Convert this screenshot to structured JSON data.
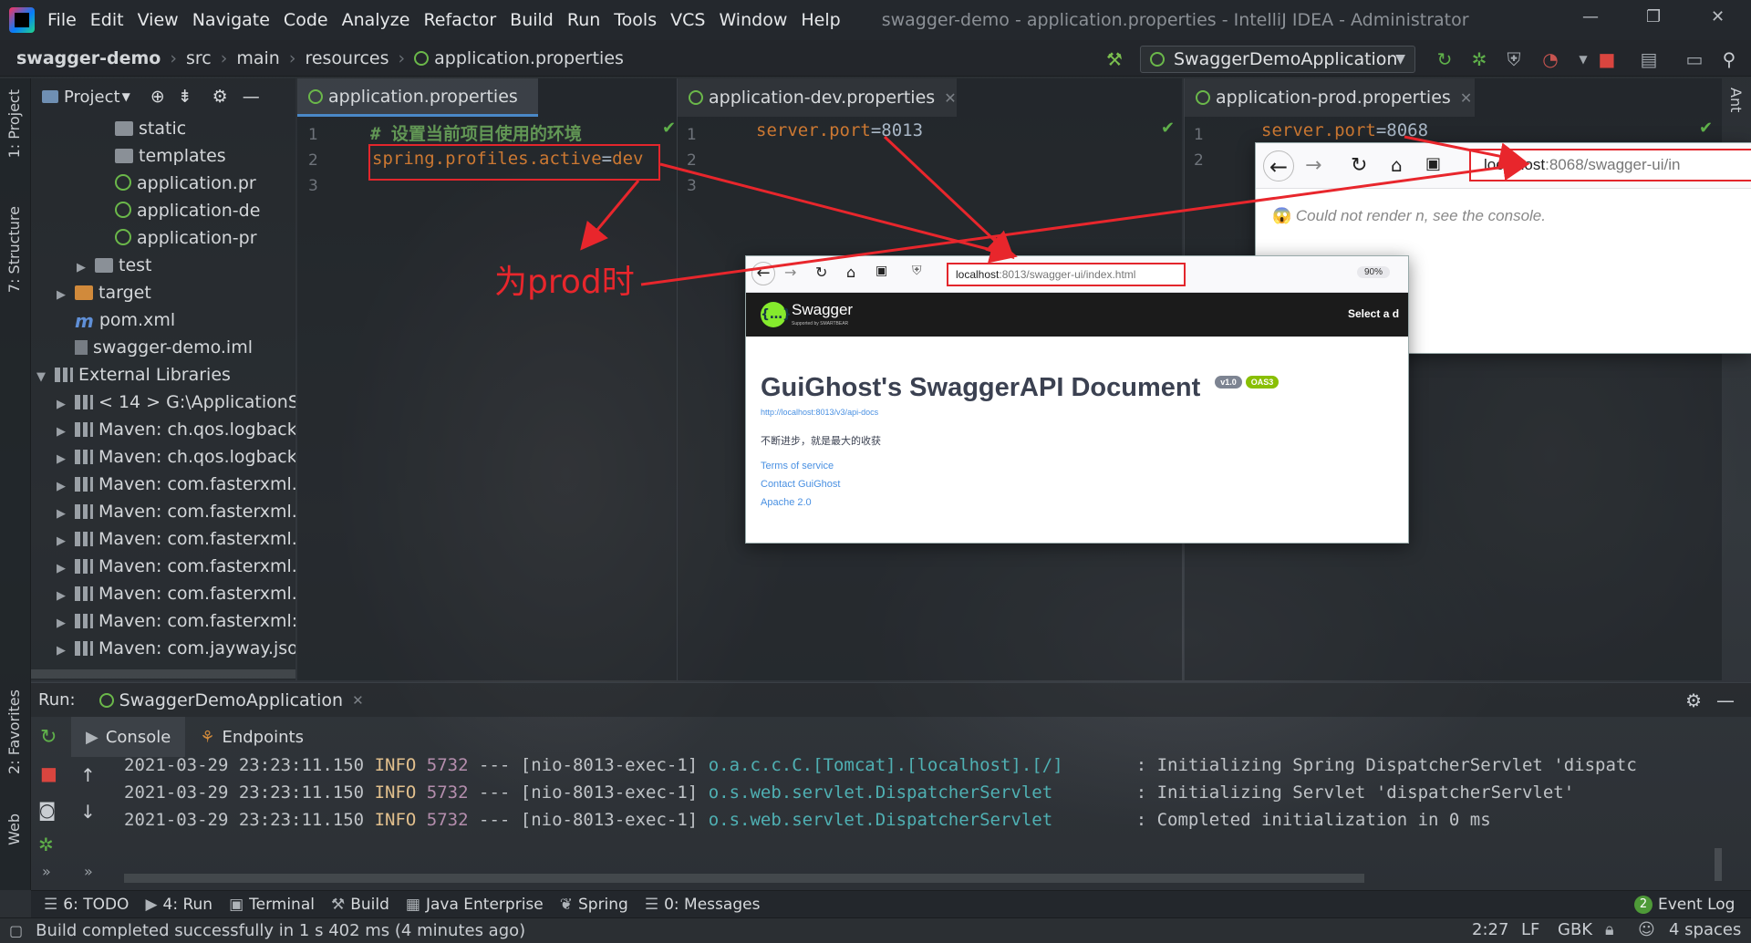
{
  "menubar": {
    "items": [
      "File",
      "Edit",
      "View",
      "Navigate",
      "Code",
      "Analyze",
      "Refactor",
      "Build",
      "Run",
      "Tools",
      "VCS",
      "Window",
      "Help"
    ],
    "title": "swagger-demo - application.properties - IntelliJ IDEA - Administrator"
  },
  "navbar": {
    "breadcrumb": [
      "swagger-demo",
      "src",
      "main",
      "resources",
      "application.properties"
    ],
    "run_config": "SwaggerDemoApplication"
  },
  "left_stripe": {
    "project": "1: Project",
    "structure": "7: Structure",
    "favorites": "2: Favorites",
    "web": "Web"
  },
  "right_stripe": {
    "ant": "Ant"
  },
  "project": {
    "header": "Project",
    "tree": [
      {
        "label": "static",
        "icon": "folder",
        "indent": 3,
        "arrow": ""
      },
      {
        "label": "templates",
        "icon": "folder",
        "indent": 3,
        "arrow": ""
      },
      {
        "label": "application.pr",
        "icon": "leaf",
        "indent": 3,
        "arrow": ""
      },
      {
        "label": "application-de",
        "icon": "leaf",
        "indent": 3,
        "arrow": ""
      },
      {
        "label": "application-pr",
        "icon": "leaf",
        "indent": 3,
        "arrow": ""
      },
      {
        "label": "test",
        "icon": "folder",
        "indent": 2,
        "arrow": "▶"
      },
      {
        "label": "target",
        "icon": "folder-orange",
        "indent": 1,
        "arrow": "▶"
      },
      {
        "label": "pom.xml",
        "icon": "maven",
        "indent": 1,
        "arrow": ""
      },
      {
        "label": "swagger-demo.iml",
        "icon": "file",
        "indent": 1,
        "arrow": ""
      },
      {
        "label": "External Libraries",
        "icon": "lib",
        "indent": 0,
        "arrow": "▼"
      },
      {
        "label": "< 14 >  G:\\ApplicationS",
        "icon": "lib",
        "indent": 1,
        "arrow": "▶"
      },
      {
        "label": "Maven: ch.qos.logback:l",
        "icon": "lib",
        "indent": 1,
        "arrow": "▶"
      },
      {
        "label": "Maven: ch.qos.logback:l",
        "icon": "lib",
        "indent": 1,
        "arrow": "▶"
      },
      {
        "label": "Maven: com.fasterxml.ja",
        "icon": "lib",
        "indent": 1,
        "arrow": "▶"
      },
      {
        "label": "Maven: com.fasterxml.ja",
        "icon": "lib",
        "indent": 1,
        "arrow": "▶"
      },
      {
        "label": "Maven: com.fasterxml.ja",
        "icon": "lib",
        "indent": 1,
        "arrow": "▶"
      },
      {
        "label": "Maven: com.fasterxml.ja",
        "icon": "lib",
        "indent": 1,
        "arrow": "▶"
      },
      {
        "label": "Maven: com.fasterxml.ja",
        "icon": "lib",
        "indent": 1,
        "arrow": "▶"
      },
      {
        "label": "Maven: com.fasterxml:cl",
        "icon": "lib",
        "indent": 1,
        "arrow": "▶"
      },
      {
        "label": "Maven: com.jayway.json",
        "icon": "lib",
        "indent": 1,
        "arrow": "▶"
      }
    ]
  },
  "editors": {
    "main": {
      "tab": "application.properties",
      "comment": "# 设置当前项目使用的环境",
      "key": "spring.profiles.active",
      "value": "dev",
      "lines": [
        "1",
        "2",
        "3"
      ]
    },
    "dev": {
      "tab": "application-dev.properties",
      "key": "server.port",
      "value": "8013",
      "lines": [
        "1",
        "2",
        "3"
      ]
    },
    "prod": {
      "tab": "application-prod.properties",
      "key": "server.port",
      "value": "8068",
      "lines": [
        "1",
        "2"
      ]
    }
  },
  "annotation": {
    "text": "为prod时",
    "color": "#e8262c"
  },
  "browser_prod": {
    "url_host": "localhost",
    "url_rest": ":8068/swagger-ui/in",
    "message": "Could not render n, see the console."
  },
  "browser_dev": {
    "url_host": "localhost",
    "url_rest": ":8013/swagger-ui/index.html",
    "zoom": "90%",
    "brand": "Swagger",
    "brand_sub": "Supported by SMARTBEAR",
    "select_label": "Select a d",
    "title": "GuiGhost's SwaggerAPI Document",
    "version_badge": "v1.0",
    "oas_badge": "OAS3",
    "api_docs_url": "http://localhost:8013/v3/api-docs",
    "description": "不断进步，就是最大的收获",
    "links": [
      "Terms of service",
      "Contact GuiGhost",
      "Apache 2.0"
    ]
  },
  "run": {
    "label": "Run:",
    "config": "SwaggerDemoApplication",
    "tabs": [
      "Console",
      "Endpoints"
    ],
    "logs": [
      {
        "time": "2021-03-29 23:23:11.150",
        "level": "INFO",
        "pid": "5732",
        "sep": "---",
        "thread": "[nio-8013-exec-1]",
        "logger": "o.a.c.c.C.[Tomcat].[localhost].[/]      ",
        "msg": ": Initializing Spring DispatcherServlet 'dispatc"
      },
      {
        "time": "2021-03-29 23:23:11.150",
        "level": "INFO",
        "pid": "5732",
        "sep": "---",
        "thread": "[nio-8013-exec-1]",
        "logger": "o.s.web.servlet.DispatcherServlet       ",
        "msg": ": Initializing Servlet 'dispatcherServlet'"
      },
      {
        "time": "2021-03-29 23:23:11.150",
        "level": "INFO",
        "pid": "5732",
        "sep": "---",
        "thread": "[nio-8013-exec-1]",
        "logger": "o.s.web.servlet.DispatcherServlet       ",
        "msg": ": Completed initialization in 0 ms"
      }
    ]
  },
  "bottom_toolbar": {
    "items": [
      {
        "icon": "todo-icon",
        "glyph": "☰",
        "label": "6: TODO"
      },
      {
        "icon": "run-icon",
        "glyph": "▶",
        "label": "4: Run"
      },
      {
        "icon": "terminal-icon",
        "glyph": "▣",
        "label": "Terminal"
      },
      {
        "icon": "build-icon",
        "glyph": "⚒",
        "label": "Build"
      },
      {
        "icon": "java-enterprise-icon",
        "glyph": "▦",
        "label": "Java Enterprise"
      },
      {
        "icon": "spring-icon",
        "glyph": "❦",
        "label": "Spring"
      },
      {
        "icon": "messages-icon",
        "glyph": "☰",
        "label": "0: Messages"
      }
    ],
    "event_log_count": "2",
    "event_log": "Event Log"
  },
  "status": {
    "message": "Build completed successfully in 1 s 402 ms (4 minutes ago)",
    "position": "2:27",
    "line_sep": "LF",
    "encoding": "GBK",
    "indent": "4 spaces"
  }
}
